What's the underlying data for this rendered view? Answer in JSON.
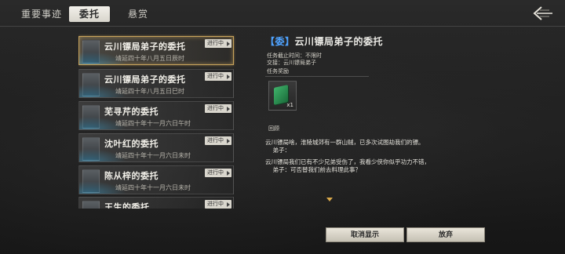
{
  "tabs": [
    {
      "label": "重要事迹",
      "active": false
    },
    {
      "label": "委托",
      "active": true
    },
    {
      "label": "悬赏",
      "active": false
    }
  ],
  "back_icon": "back-arrow-icon",
  "quests": [
    {
      "title": "云川镖局弟子的委托",
      "date": "靖延四十年八月五日辰时",
      "status": "进行中",
      "selected": true
    },
    {
      "title": "云川镖局弟子的委托",
      "date": "靖延四十年八月五日巳时",
      "status": "进行中",
      "selected": false
    },
    {
      "title": "芜寻芹的委托",
      "date": "靖延四十年十一月六日午时",
      "status": "进行中",
      "selected": false
    },
    {
      "title": "沈叶红的委托",
      "date": "靖延四十年十一月六日未时",
      "status": "进行中",
      "selected": false
    },
    {
      "title": "陈从梓的委托",
      "date": "靖延四十年十一月六日未时",
      "status": "进行中",
      "selected": false
    },
    {
      "title": "王生的委托",
      "date": "",
      "status": "进行中",
      "selected": false
    }
  ],
  "detail": {
    "mark": "【委】",
    "title": "云川镖局弟子的委托",
    "deadline": "任务截止时间：不限时",
    "giver": "交接：云川镖局弟子",
    "reward_label": "任务奖励",
    "reward": {
      "icon": "green-book-icon",
      "qty": "x1"
    },
    "review_label": "回顾",
    "paragraphs": [
      "云川镖局啥，淮陵城郊有一群山贼，已多次试图劫我们的镖。",
      "    弟子：",
      "云川镖局我们已有不少兄弟受伤了，我看少侠你似乎功力不错，",
      "    弟子：可否替我们前去料理此事？"
    ]
  },
  "buttons": {
    "cancel_display": "取消显示",
    "abandon": "放弃"
  },
  "colors": {
    "accent_blue": "#4fa3ff",
    "selected_border": "#c9a45c",
    "scroll_arrow": "#d9a84a"
  }
}
